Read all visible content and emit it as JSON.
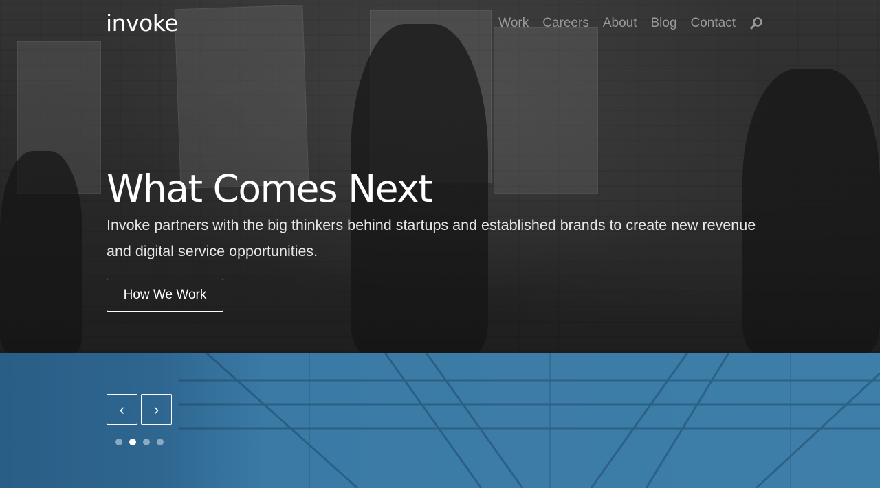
{
  "brand": {
    "logo_text": "invoke"
  },
  "nav": {
    "items": [
      {
        "label": "Work"
      },
      {
        "label": "Careers"
      },
      {
        "label": "About"
      },
      {
        "label": "Blog"
      },
      {
        "label": "Contact"
      }
    ],
    "search_icon": "search-icon"
  },
  "hero": {
    "headline": "What Comes Next",
    "lede": "Invoke partners with the big thinkers behind startups and established brands to create new revenue and digital service opportunities.",
    "cta_label": "How We Work"
  },
  "slider": {
    "prev_symbol": "‹",
    "next_symbol": "›",
    "dot_count": 4,
    "active_dot": 2
  },
  "colors": {
    "hero_overlay": "#2e2e2e",
    "band_blue": "#3a7aa5",
    "nav_text": "#9a9a9a",
    "text_white": "#ffffff"
  }
}
